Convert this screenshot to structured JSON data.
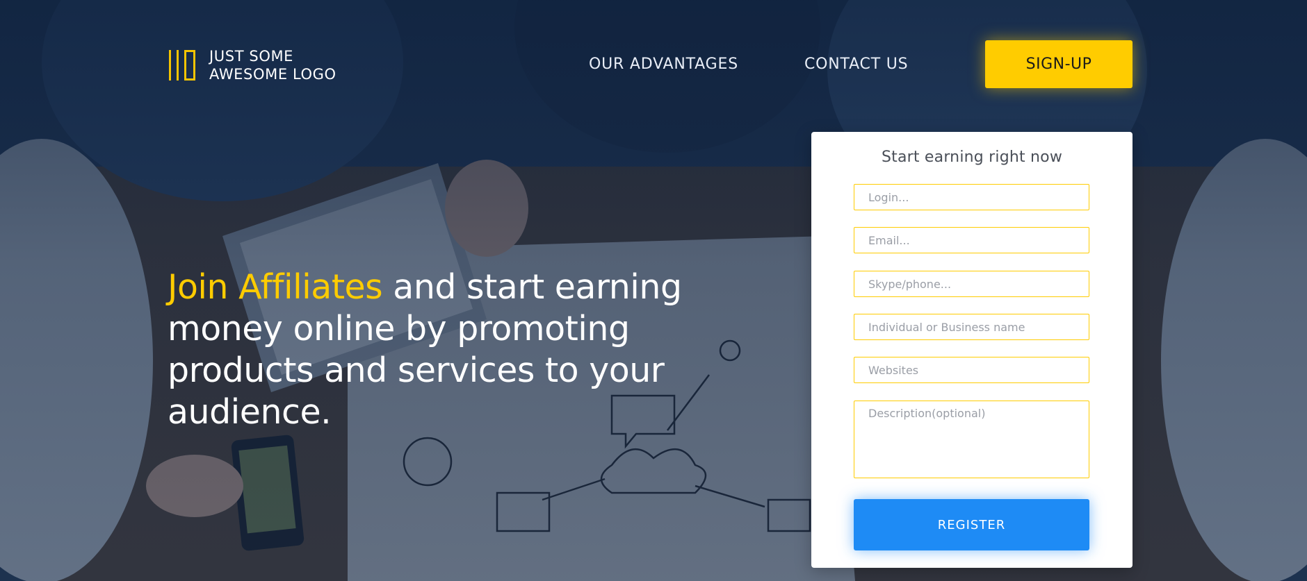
{
  "header": {
    "logo_line1": "JUST SOME",
    "logo_line2": "AWESOME LOGO",
    "nav": {
      "advantages_label": "OUR ADVANTAGES",
      "contact_label": "CONTACT US"
    },
    "signup_label": "SIGN-UP"
  },
  "hero": {
    "highlight": "Join Affiliates",
    "rest": " and start earning money online by promoting products and services to your audience."
  },
  "form": {
    "title": "Start earning right now",
    "login_placeholder": "Login...",
    "email_placeholder": "Email...",
    "skype_placeholder": "Skype/phone...",
    "business_placeholder": "Individual or Business name",
    "websites_placeholder": "Websites",
    "description_placeholder": "Description(optional)",
    "register_label": "REGISTER"
  },
  "colors": {
    "accent_yellow": "#ffcc00",
    "button_blue": "#1e8bf5",
    "overlay_navy": "#0a1c38"
  },
  "icons": {
    "logo": "bars-logo-icon"
  }
}
